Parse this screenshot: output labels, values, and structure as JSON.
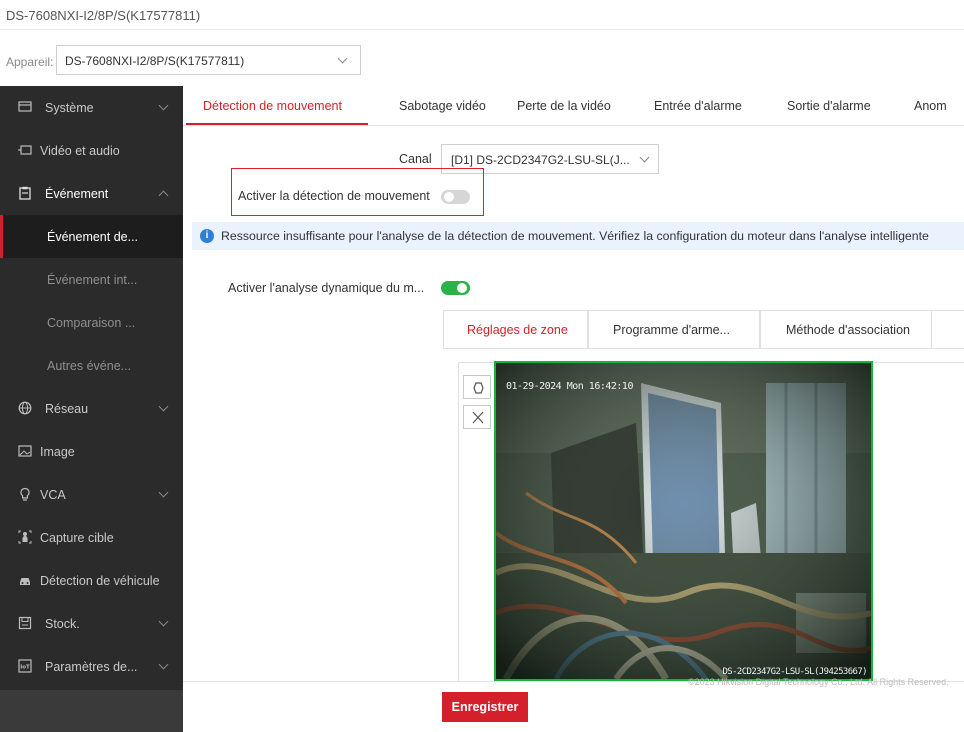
{
  "window": {
    "title": "DS-7608NXI-I2/8P/S(K17577811)"
  },
  "device": {
    "label": "Appareil:",
    "value": "DS-7608NXI-I2/8P/S(K17577811)"
  },
  "sidebar": {
    "items": [
      {
        "label": "Système",
        "icon": "monitor-icon"
      },
      {
        "label": "Vidéo et audio",
        "icon": "video-icon"
      },
      {
        "label": "Événement",
        "icon": "clipboard-icon"
      },
      {
        "label": "Événement de...",
        "icon": ""
      },
      {
        "label": "Événement int...",
        "icon": ""
      },
      {
        "label": "Comparaison ...",
        "icon": ""
      },
      {
        "label": "Autres événe...",
        "icon": ""
      },
      {
        "label": "Réseau",
        "icon": "globe-icon"
      },
      {
        "label": "Image",
        "icon": "image-icon"
      },
      {
        "label": "VCA",
        "icon": "lightbulb-icon"
      },
      {
        "label": "Capture cible",
        "icon": "target-person-icon"
      },
      {
        "label": "Détection de véhicule",
        "icon": "car-icon"
      },
      {
        "label": "Stock.",
        "icon": "storage-icon"
      },
      {
        "label": "Paramètres de...",
        "icon": "iot-icon"
      }
    ]
  },
  "tabs": [
    {
      "label": "Détection de mouvement",
      "active": true
    },
    {
      "label": "Sabotage vidéo"
    },
    {
      "label": "Perte de la vidéo"
    },
    {
      "label": "Entrée d'alarme"
    },
    {
      "label": "Sortie d'alarme"
    },
    {
      "label": "Anom"
    }
  ],
  "form": {
    "canal_label": "Canal",
    "canal_value": "[D1] DS-2CD2347G2-LSU-SL(J...",
    "enable_motion_label": "Activer la détection de mouvement",
    "enable_motion_on": false,
    "notice": "Ressource insuffisante pour l'analyse de la détection de mouvement. Vérifiez la configuration du moteur dans l'analyse intelligente",
    "dynamic_label": "Activer l'analyse dynamique du m...",
    "dynamic_on": true
  },
  "subtabs": [
    {
      "label": "Réglages de zone",
      "active": true
    },
    {
      "label": "Programme d'arme..."
    },
    {
      "label": "Méthode d'association"
    }
  ],
  "video": {
    "osd_time": "01-29-2024 Mon 16:42:10",
    "osd_name": "DS-2CD2347G2-LSU-SL(J94253667)"
  },
  "footer": {
    "copyright": "©2023 Hikvision Digital Technology Co., Ltd. All Rights Reserved.",
    "save_label": "Enregistrer"
  },
  "colors": {
    "accent": "#d51f2a",
    "toggle_on": "#29b349",
    "sidebar_bg": "#2b2b2b",
    "notice_bg": "#e9f2fd"
  }
}
